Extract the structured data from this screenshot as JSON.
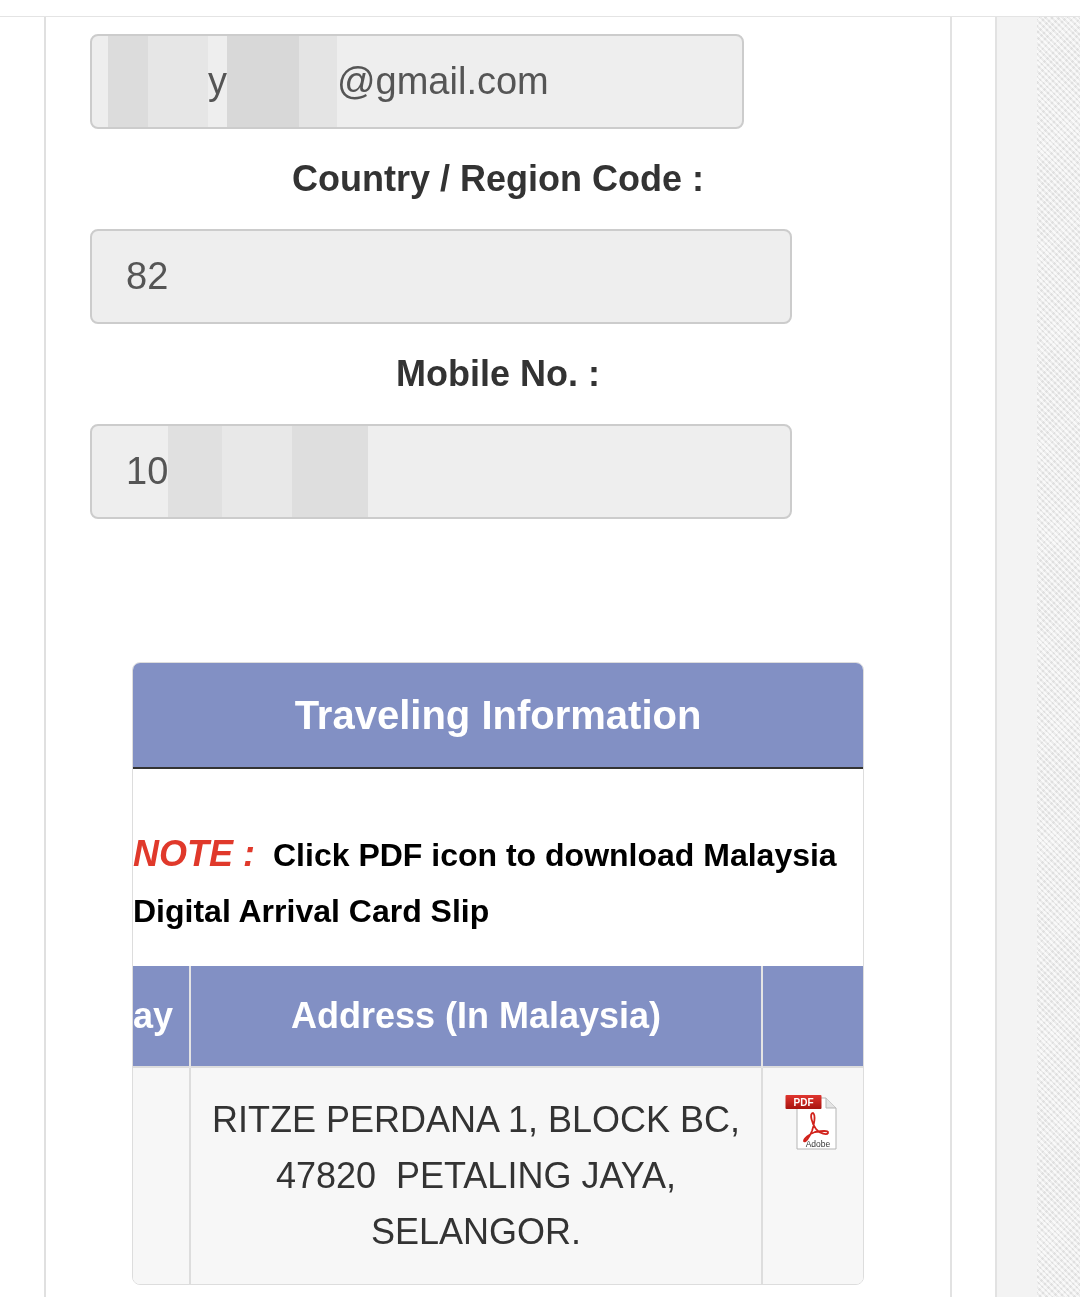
{
  "form": {
    "fields": [
      {
        "segments": [
          {
            "kind": "redaction"
          },
          {
            "kind": "text",
            "text": "y"
          },
          {
            "kind": "redaction"
          },
          {
            "kind": "text",
            "text": "@gmail.com"
          }
        ]
      },
      {
        "label": "Country / Region Code :",
        "segments": [
          {
            "kind": "text",
            "text": "82"
          }
        ]
      },
      {
        "label": "Mobile No. :",
        "segments": [
          {
            "kind": "text",
            "text": "10"
          },
          {
            "kind": "redaction"
          }
        ]
      }
    ]
  },
  "traveling_information": {
    "title": "Traveling Information",
    "note": {
      "label": "NOTE :",
      "text": "Click PDF icon to download Malaysia Digital Arrival Card Slip"
    },
    "table": {
      "columns": [
        {
          "kind": "text",
          "label": "ay"
        },
        {
          "kind": "text",
          "label": "Address (In Malaysia)"
        },
        {
          "kind": "blank"
        }
      ],
      "rows": [
        {
          "cells": [
            {
              "kind": "blank"
            },
            {
              "kind": "text",
              "text": "RITZE PERDANA 1, BLOCK BC, 47820  PETALING JAYA, SELANGOR."
            },
            {
              "kind": "pdf",
              "badge": "PDF",
              "caption": "Adobe"
            }
          ]
        }
      ]
    }
  }
}
